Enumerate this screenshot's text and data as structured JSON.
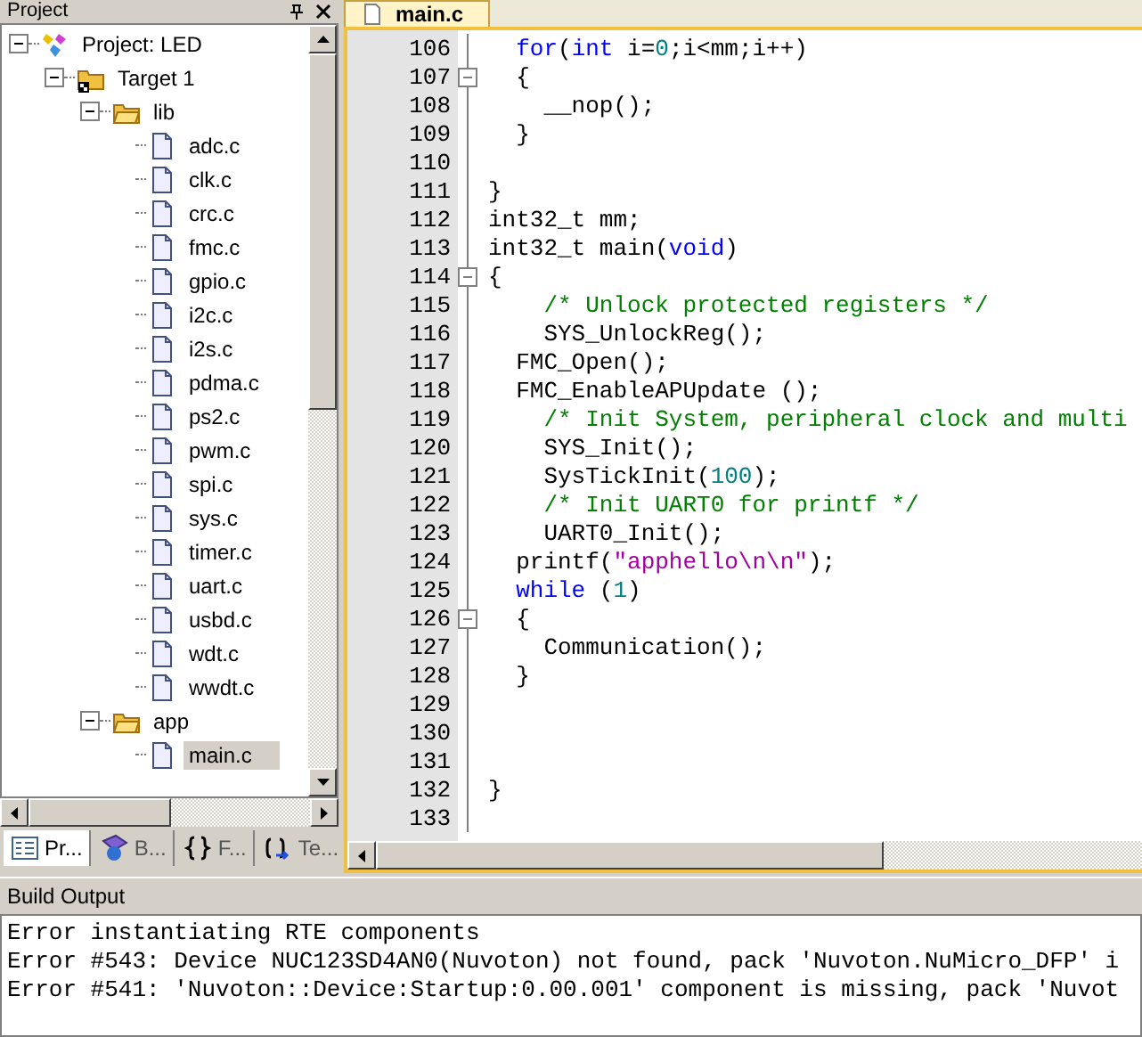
{
  "project_panel": {
    "title": "Project",
    "tree": [
      {
        "kind": "project",
        "label": "Project: LED",
        "expanded": true,
        "selected": false,
        "children": [
          {
            "kind": "target",
            "label": "Target 1",
            "expanded": true,
            "selected": false,
            "children": [
              {
                "kind": "folder",
                "label": "lib",
                "expanded": true,
                "selected": false,
                "children": [
                  {
                    "kind": "file",
                    "label": "adc.c",
                    "selected": false
                  },
                  {
                    "kind": "file",
                    "label": "clk.c",
                    "selected": false
                  },
                  {
                    "kind": "file",
                    "label": "crc.c",
                    "selected": false
                  },
                  {
                    "kind": "file",
                    "label": "fmc.c",
                    "selected": false
                  },
                  {
                    "kind": "file",
                    "label": "gpio.c",
                    "selected": false
                  },
                  {
                    "kind": "file",
                    "label": "i2c.c",
                    "selected": false
                  },
                  {
                    "kind": "file",
                    "label": "i2s.c",
                    "selected": false
                  },
                  {
                    "kind": "file",
                    "label": "pdma.c",
                    "selected": false
                  },
                  {
                    "kind": "file",
                    "label": "ps2.c",
                    "selected": false
                  },
                  {
                    "kind": "file",
                    "label": "pwm.c",
                    "selected": false
                  },
                  {
                    "kind": "file",
                    "label": "spi.c",
                    "selected": false
                  },
                  {
                    "kind": "file",
                    "label": "sys.c",
                    "selected": false
                  },
                  {
                    "kind": "file",
                    "label": "timer.c",
                    "selected": false
                  },
                  {
                    "kind": "file",
                    "label": "uart.c",
                    "selected": false
                  },
                  {
                    "kind": "file",
                    "label": "usbd.c",
                    "selected": false
                  },
                  {
                    "kind": "file",
                    "label": "wdt.c",
                    "selected": false
                  },
                  {
                    "kind": "file",
                    "label": "wwdt.c",
                    "selected": false
                  }
                ]
              },
              {
                "kind": "folder",
                "label": "app",
                "expanded": true,
                "selected": false,
                "children": [
                  {
                    "kind": "file",
                    "label": "main.c",
                    "selected": true
                  }
                ]
              }
            ]
          }
        ]
      }
    ],
    "tabs": [
      {
        "kind": "project",
        "label": "Pr...",
        "selected": true
      },
      {
        "kind": "books",
        "label": "B...",
        "selected": false
      },
      {
        "kind": "functions",
        "label": "F...",
        "selected": false
      },
      {
        "kind": "templates",
        "label": "Te...",
        "selected": false
      }
    ]
  },
  "editor": {
    "tab": {
      "label": "main.c",
      "selected": true
    },
    "lines": [
      {
        "number": "106",
        "fold_box": false,
        "segments": [
          {
            "kind": "keyword",
            "text": "  for"
          },
          {
            "kind": "plain",
            "text": "("
          },
          {
            "kind": "keyword",
            "text": "int"
          },
          {
            "kind": "plain",
            "text": " i="
          },
          {
            "kind": "number",
            "text": "0"
          },
          {
            "kind": "plain",
            "text": ";i<mm;i++)"
          }
        ]
      },
      {
        "number": "107",
        "fold_box": true,
        "segments": [
          {
            "kind": "plain",
            "text": "  {"
          }
        ]
      },
      {
        "number": "108",
        "fold_box": false,
        "segments": [
          {
            "kind": "plain",
            "text": "    __nop();"
          }
        ]
      },
      {
        "number": "109",
        "fold_box": false,
        "segments": [
          {
            "kind": "plain",
            "text": "  }"
          }
        ]
      },
      {
        "number": "110",
        "fold_box": false
      },
      {
        "number": "111",
        "fold_box": false,
        "segments": [
          {
            "kind": "plain",
            "text": "}"
          }
        ]
      },
      {
        "number": "112",
        "fold_box": false,
        "segments": [
          {
            "kind": "plain",
            "text": "int32_t mm;"
          }
        ]
      },
      {
        "number": "113",
        "fold_box": false,
        "segments": [
          {
            "kind": "plain",
            "text": "int32_t main("
          },
          {
            "kind": "keyword",
            "text": "void"
          },
          {
            "kind": "plain",
            "text": ")"
          }
        ]
      },
      {
        "number": "114",
        "fold_box": true,
        "segments": [
          {
            "kind": "plain",
            "text": "{"
          }
        ]
      },
      {
        "number": "115",
        "fold_box": false,
        "segments": [
          {
            "kind": "comment",
            "text": "    /* Unlock protected registers */"
          }
        ]
      },
      {
        "number": "116",
        "fold_box": false,
        "segments": [
          {
            "kind": "plain",
            "text": "    SYS_UnlockReg();"
          }
        ]
      },
      {
        "number": "117",
        "fold_box": false,
        "segments": [
          {
            "kind": "plain",
            "text": "  FMC_Open();"
          }
        ]
      },
      {
        "number": "118",
        "fold_box": false,
        "segments": [
          {
            "kind": "plain",
            "text": "  FMC_EnableAPUpdate ();"
          }
        ]
      },
      {
        "number": "119",
        "fold_box": false,
        "segments": [
          {
            "kind": "comment",
            "text": "    /* Init System, peripheral clock and multi"
          }
        ]
      },
      {
        "number": "120",
        "fold_box": false,
        "segments": [
          {
            "kind": "plain",
            "text": "    SYS_Init();"
          }
        ]
      },
      {
        "number": "121",
        "fold_box": false,
        "segments": [
          {
            "kind": "plain",
            "text": "    SysTickInit("
          },
          {
            "kind": "number",
            "text": "100"
          },
          {
            "kind": "plain",
            "text": ");"
          }
        ]
      },
      {
        "number": "122",
        "fold_box": false,
        "segments": [
          {
            "kind": "comment",
            "text": "    /* Init UART0 for printf */"
          }
        ]
      },
      {
        "number": "123",
        "fold_box": false,
        "segments": [
          {
            "kind": "plain",
            "text": "    UART0_Init();"
          }
        ]
      },
      {
        "number": "124",
        "fold_box": false,
        "segments": [
          {
            "kind": "plain",
            "text": "  printf("
          },
          {
            "kind": "string",
            "text": "\"apphello\\n\\n\""
          },
          {
            "kind": "plain",
            "text": ");"
          }
        ]
      },
      {
        "number": "125",
        "fold_box": false,
        "segments": [
          {
            "kind": "keyword",
            "text": "  while"
          },
          {
            "kind": "plain",
            "text": " ("
          },
          {
            "kind": "number",
            "text": "1"
          },
          {
            "kind": "plain",
            "text": ")"
          }
        ]
      },
      {
        "number": "126",
        "fold_box": true,
        "segments": [
          {
            "kind": "plain",
            "text": "  {"
          }
        ]
      },
      {
        "number": "127",
        "fold_box": false,
        "segments": [
          {
            "kind": "plain",
            "text": "    Communication();"
          }
        ]
      },
      {
        "number": "128",
        "fold_box": false,
        "segments": [
          {
            "kind": "plain",
            "text": "  }"
          }
        ]
      },
      {
        "number": "129",
        "fold_box": false
      },
      {
        "number": "130",
        "fold_box": false
      },
      {
        "number": "131",
        "fold_box": false
      },
      {
        "number": "132",
        "fold_box": false,
        "segments": [
          {
            "kind": "plain",
            "text": "}"
          }
        ]
      },
      {
        "number": "133",
        "fold_box": false
      }
    ]
  },
  "build_output": {
    "title": "Build Output",
    "lines": [
      "Error instantiating RTE components",
      "Error #543: Device NUC123SD4AN0(Nuvoton) not found, pack 'Nuvoton.NuMicro_DFP' i",
      "Error #541: 'Nuvoton::Device:Startup:0.00.001' component is missing, pack 'Nuvot"
    ]
  }
}
